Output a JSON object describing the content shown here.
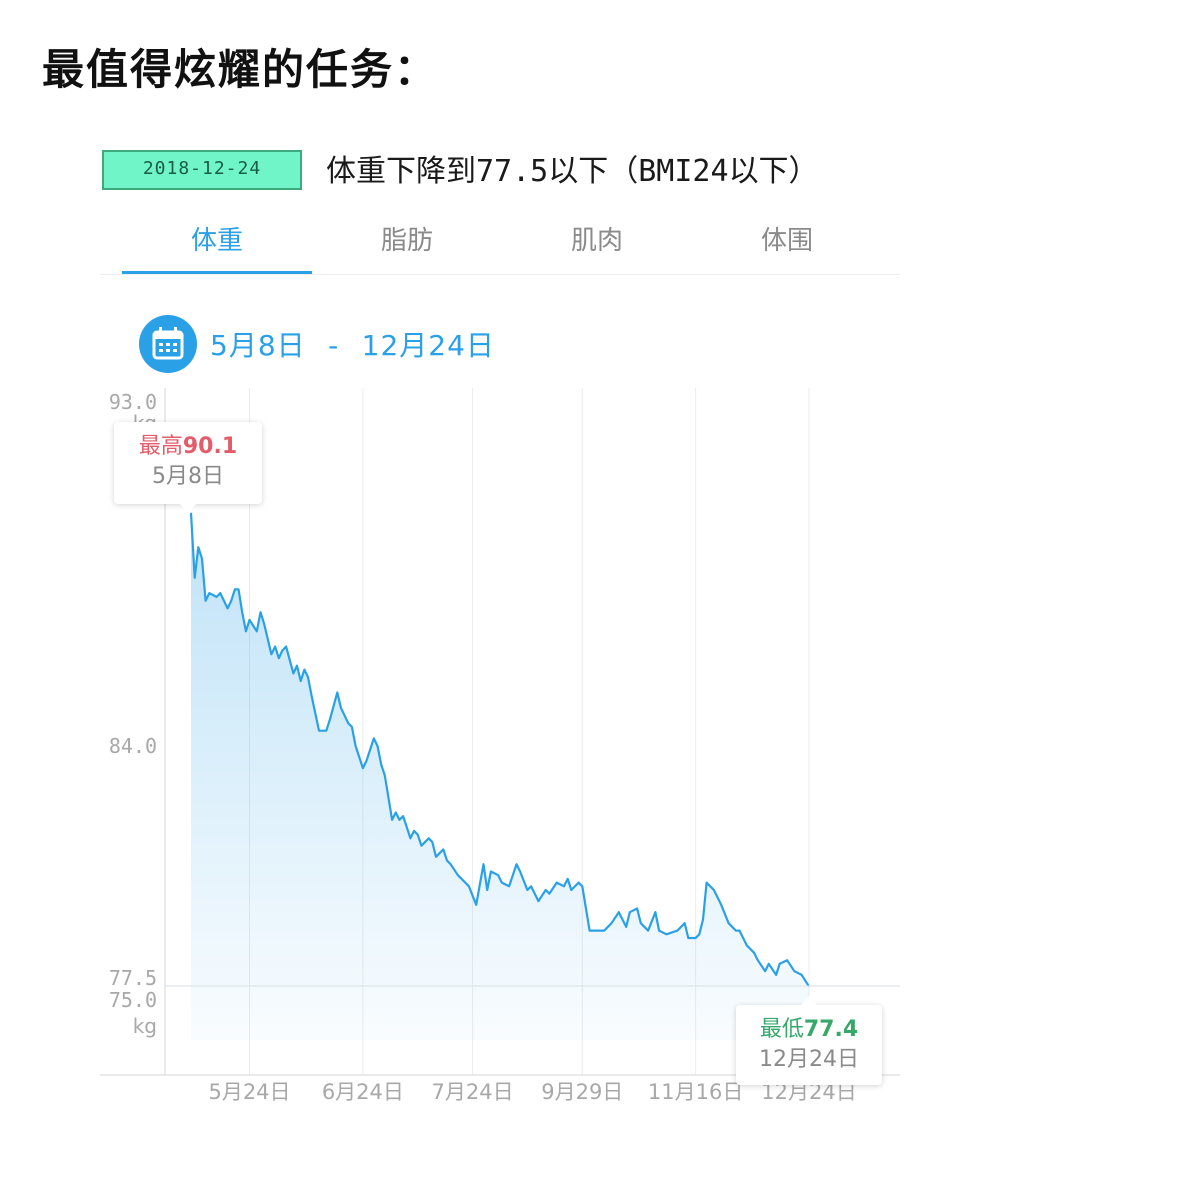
{
  "heading": "最值得炫耀的任务：",
  "task": {
    "date": "2018-12-24",
    "goal_prefix": "体重下降到",
    "goal_value": "77.5",
    "goal_middle": "以下（",
    "goal_bmi": "BMI24",
    "goal_suffix": "以下）"
  },
  "tabs": [
    {
      "label": "体重",
      "active": true
    },
    {
      "label": "脂肪",
      "active": false
    },
    {
      "label": "肌肉",
      "active": false
    },
    {
      "label": "体围",
      "active": false
    }
  ],
  "date_range": {
    "icon": "calendar-icon",
    "start": "5月8日",
    "separator": "-",
    "end": "12月24日"
  },
  "colors": {
    "accent": "#2aa0e6",
    "max": "#e25c6a",
    "min": "#37a86b",
    "badge": "#6ff5c8"
  },
  "tooltips": {
    "max": {
      "label": "最高",
      "value": "90.1",
      "date": "5月8日"
    },
    "min": {
      "label": "最低",
      "value": "77.4",
      "date": "12月24日"
    }
  },
  "chart_data": {
    "type": "area",
    "unit": "kg",
    "y_ticks": [
      "93.0",
      "84.0",
      "77.5",
      "75.0"
    ],
    "ylim": [
      75.0,
      93.0
    ],
    "goal_line": 77.5,
    "x_ticks": [
      {
        "label": "5月24日",
        "day": 16
      },
      {
        "label": "6月24日",
        "day": 47
      },
      {
        "label": "7月24日",
        "day": 77
      },
      {
        "label": "9月29日",
        "day": 107
      },
      {
        "label": "11月16日",
        "day": 138
      },
      {
        "label": "12月24日",
        "day": 169
      }
    ],
    "xlim": [
      -5,
      185
    ],
    "series": [
      {
        "values": [
          [
            0,
            90.1
          ],
          [
            1,
            88.4
          ],
          [
            2,
            89.2
          ],
          [
            3,
            88.9
          ],
          [
            4,
            87.8
          ],
          [
            5,
            88.0
          ],
          [
            7,
            87.9
          ],
          [
            8,
            88.0
          ],
          [
            10,
            87.6
          ],
          [
            11,
            87.8
          ],
          [
            12,
            88.1
          ],
          [
            13,
            88.1
          ],
          [
            14,
            87.5
          ],
          [
            15,
            87.0
          ],
          [
            16,
            87.3
          ],
          [
            18,
            87.0
          ],
          [
            19,
            87.5
          ],
          [
            20,
            87.2
          ],
          [
            22,
            86.4
          ],
          [
            23,
            86.6
          ],
          [
            24,
            86.3
          ],
          [
            25,
            86.5
          ],
          [
            26,
            86.6
          ],
          [
            28,
            85.9
          ],
          [
            29,
            86.1
          ],
          [
            30,
            85.7
          ],
          [
            31,
            86.0
          ],
          [
            32,
            85.8
          ],
          [
            33,
            85.3
          ],
          [
            35,
            84.4
          ],
          [
            37,
            84.4
          ],
          [
            38,
            84.7
          ],
          [
            40,
            85.4
          ],
          [
            41,
            85.0
          ],
          [
            43,
            84.6
          ],
          [
            44,
            84.5
          ],
          [
            45,
            84.0
          ],
          [
            47,
            83.4
          ],
          [
            48,
            83.6
          ],
          [
            50,
            84.2
          ],
          [
            51,
            84.0
          ],
          [
            52,
            83.5
          ],
          [
            53,
            83.2
          ],
          [
            55,
            82.0
          ],
          [
            56,
            82.2
          ],
          [
            57,
            82.0
          ],
          [
            58,
            82.1
          ],
          [
            59,
            81.8
          ],
          [
            60,
            81.5
          ],
          [
            61,
            81.7
          ],
          [
            62,
            81.6
          ],
          [
            63,
            81.3
          ],
          [
            65,
            81.5
          ],
          [
            66,
            81.4
          ],
          [
            67,
            81.0
          ],
          [
            69,
            81.2
          ],
          [
            70,
            80.9
          ],
          [
            71,
            80.8
          ],
          [
            73,
            80.5
          ],
          [
            75,
            80.3
          ],
          [
            76,
            80.2
          ],
          [
            78,
            79.7
          ],
          [
            80,
            80.8
          ],
          [
            81,
            80.1
          ],
          [
            82,
            80.6
          ],
          [
            84,
            80.5
          ],
          [
            85,
            80.3
          ],
          [
            87,
            80.2
          ],
          [
            89,
            80.8
          ],
          [
            90,
            80.6
          ],
          [
            92,
            80.1
          ],
          [
            93,
            80.2
          ],
          [
            95,
            79.8
          ],
          [
            97,
            80.1
          ],
          [
            98,
            80.0
          ],
          [
            100,
            80.3
          ],
          [
            102,
            80.2
          ],
          [
            103,
            80.4
          ],
          [
            104,
            80.1
          ],
          [
            106,
            80.3
          ],
          [
            107,
            80.2
          ],
          [
            109,
            79.0
          ],
          [
            111,
            79.0
          ],
          [
            113,
            79.0
          ],
          [
            115,
            79.2
          ],
          [
            117,
            79.5
          ],
          [
            118,
            79.3
          ],
          [
            119,
            79.1
          ],
          [
            120,
            79.5
          ],
          [
            122,
            79.6
          ],
          [
            123,
            79.2
          ],
          [
            125,
            79.0
          ],
          [
            127,
            79.5
          ],
          [
            128,
            79.0
          ],
          [
            130,
            78.9
          ],
          [
            133,
            79.0
          ],
          [
            135,
            79.2
          ],
          [
            136,
            78.8
          ],
          [
            138,
            78.8
          ],
          [
            139,
            78.9
          ],
          [
            140,
            79.3
          ],
          [
            141,
            80.3
          ],
          [
            143,
            80.1
          ],
          [
            145,
            79.7
          ],
          [
            147,
            79.2
          ],
          [
            149,
            79.0
          ],
          [
            150,
            79.0
          ],
          [
            152,
            78.6
          ],
          [
            154,
            78.4
          ],
          [
            155,
            78.2
          ],
          [
            157,
            77.9
          ],
          [
            158,
            78.1
          ],
          [
            160,
            77.8
          ],
          [
            161,
            78.1
          ],
          [
            163,
            78.2
          ],
          [
            165,
            77.9
          ],
          [
            167,
            77.8
          ],
          [
            169,
            77.4
          ]
        ]
      }
    ]
  }
}
